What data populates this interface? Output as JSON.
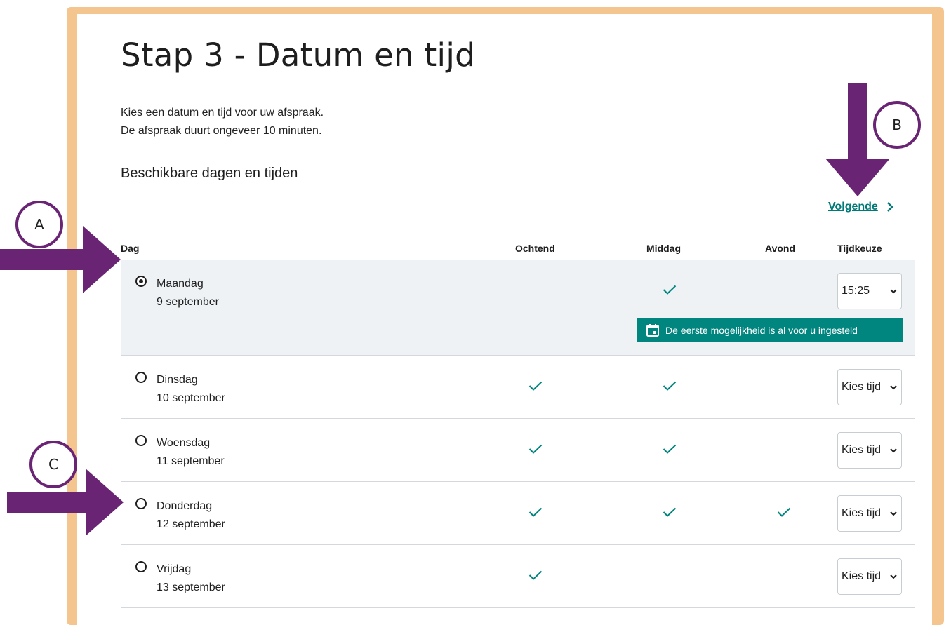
{
  "page": {
    "title": "Stap 3 - Datum en tijd",
    "intro_line1": "Kies een datum en tijd voor uw afspraak.",
    "intro_line2": "De afspraak duurt ongeveer 10 minuten.",
    "section_title": "Beschikbare dagen en tijden",
    "next_label": "Volgende"
  },
  "table": {
    "headers": {
      "day": "Dag",
      "morning": "Ochtend",
      "afternoon": "Middag",
      "evening": "Avond",
      "time": "Tijdkeuze"
    },
    "rows": [
      {
        "day": "Maandag",
        "date": "9 september",
        "selected": true,
        "morning": false,
        "afternoon": true,
        "evening": false,
        "time_value": "15:25"
      },
      {
        "day": "Dinsdag",
        "date": "10 september",
        "selected": false,
        "morning": true,
        "afternoon": true,
        "evening": false,
        "time_value": "Kies tijd"
      },
      {
        "day": "Woensdag",
        "date": "11 september",
        "selected": false,
        "morning": true,
        "afternoon": true,
        "evening": false,
        "time_value": "Kies tijd"
      },
      {
        "day": "Donderdag",
        "date": "12 september",
        "selected": false,
        "morning": true,
        "afternoon": true,
        "evening": true,
        "time_value": "Kies tijd"
      },
      {
        "day": "Vrijdag",
        "date": "13 september",
        "selected": false,
        "morning": true,
        "afternoon": false,
        "evening": false,
        "time_value": "Kies tijd"
      }
    ],
    "notice": "De eerste mogelijkheid is al voor u ingesteld"
  },
  "annotations": {
    "a": "A",
    "b": "B",
    "c": "C"
  },
  "colors": {
    "accent": "#007a78",
    "notice_bg": "#00857f",
    "frame": "#f4c58e",
    "arrow": "#6a2474",
    "selected_row": "#eef2f5"
  }
}
